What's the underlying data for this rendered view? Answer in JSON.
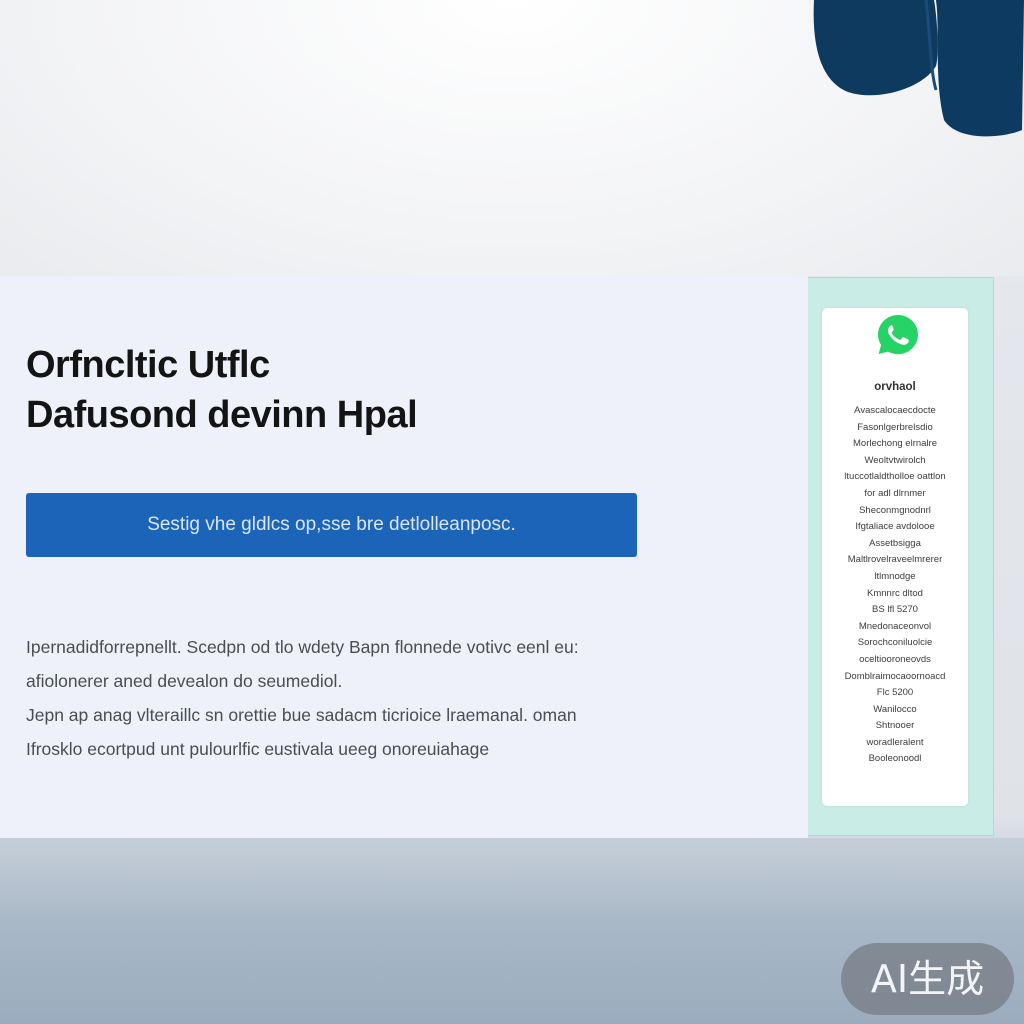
{
  "hero": {
    "title_line1": "Orfncltic Utflc",
    "title_line2": "Dafusond devinn Hpal",
    "cta_label": "Sestig vhe gldlcs op,sse bre detlolleanposc.",
    "body_lines": [
      "Ipernadidforrepnellt. Scedpn od tlo wdety Bapn flonnede votivc eenl eu:",
      "afiolonerer aned devealon do seumediol.",
      "Jepn ap anag vlteraillc sn orettie bue sadacm ticrioice lraemanal. oman",
      "Ifrosklo ecortpud unt pulourlfic eustivala ueeg onoreuiahage"
    ]
  },
  "sidebar": {
    "icon": "whatsapp-icon",
    "heading": "orvhaol",
    "items": [
      "Avascalocaecdocte",
      "Fasonlgerbrelsdio",
      "Morlechong elrnalre",
      "Weoltvtwirolch",
      "ltuccotlaldtholloe oattlon",
      "for adl dlrnmer",
      "Sheconmgnodnrl",
      "Ifgtaliace avdolooe",
      "Assetbsigga",
      "Maltlrovelraveelmrerer",
      "ltlmnodge",
      "Kmnnrc dltod",
      "BS lfl 5270",
      "Mnedonaceonvol",
      "Sorochconiluolcie",
      "oceltiooroneovds",
      "Domblraimocaoornoacd",
      "Flc 5200",
      "Wanilocco",
      "Shtnooer",
      "woradleralent",
      "Booleonoodl"
    ]
  },
  "watermark": "AI生成",
  "colors": {
    "cta_background": "#1c64b8",
    "side_panel": "#c9ece6",
    "whatsapp_green": "#25d366"
  }
}
